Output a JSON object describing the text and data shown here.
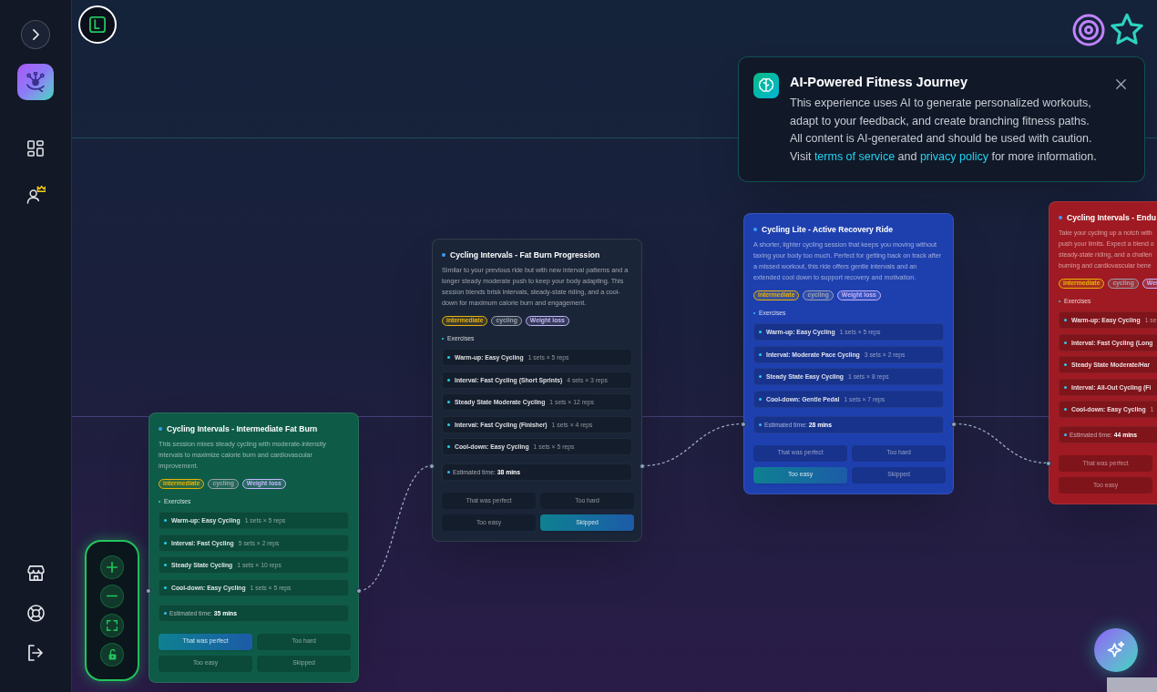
{
  "notice": {
    "title": "AI-Powered Fitness Journey",
    "body": [
      {
        "kind": "text",
        "text": "This experience uses AI to generate personalized workouts, adapt to your feedback, and create branching fitness paths. All content is AI-generated and should be used with caution. Visit "
      },
      {
        "kind": "link",
        "text": "terms of service"
      },
      {
        "kind": "text",
        "text": " and "
      },
      {
        "kind": "link",
        "text": "privacy policy"
      },
      {
        "kind": "text",
        "text": " for more information."
      }
    ]
  },
  "cards": [
    {
      "title": "Cycling Intervals - Intermediate Fat Burn",
      "description": "This session mixes steady cycling with moderate-intensity intervals to maximize calorie burn and cardiovascular improvement.",
      "color": "#0e5c48",
      "tags": [
        {
          "label": "intermediate",
          "color": "#eab308"
        },
        {
          "label": "cycling",
          "color": "#9ca3af"
        },
        {
          "label": "Weight loss",
          "color": "#c4b5fd"
        }
      ],
      "exercises_heading": "Exercises",
      "exercises": [
        {
          "name": "Warm-up: Easy Cycling",
          "detail": "1 sets × 5 reps"
        },
        {
          "name": "Interval: Fast Cycling",
          "detail": "5 sets × 2 reps"
        },
        {
          "name": "Steady State Cycling",
          "detail": "1 sets × 10 reps"
        },
        {
          "name": "Cool-down: Easy Cycling",
          "detail": "1 sets × 5 reps"
        }
      ],
      "estimate": "Estimated time: **35 mins**",
      "feedback": [
        [
          {
            "label": "That was perfect",
            "selected": true
          },
          {
            "label": "Too hard",
            "selected": false
          }
        ],
        [
          {
            "label": "Too easy",
            "selected": false
          },
          {
            "label": "Skipped",
            "selected": false
          }
        ]
      ]
    },
    {
      "title": "Cycling Intervals - Fat Burn Progression",
      "description": "Similar to your previous ride but with new interval patterns and a longer steady moderate push to keep your body adapting. This session blends brisk intervals, steady-state riding, and a cool-down for maximum calorie burn and engagement.",
      "color": "#1a2538",
      "tags": [
        {
          "label": "intermediate",
          "color": "#eab308"
        },
        {
          "label": "cycling",
          "color": "#9ca3af"
        },
        {
          "label": "Weight loss",
          "color": "#c4b5fd"
        }
      ],
      "exercises_heading": "Exercises",
      "exercises": [
        {
          "name": "Warm-up: Easy Cycling",
          "detail": "1 sets × 5 reps"
        },
        {
          "name": "Interval: Fast Cycling (Short Sprints)",
          "detail": "4 sets × 3 reps"
        },
        {
          "name": "Steady State Moderate Cycling",
          "detail": "1 sets × 12 reps"
        },
        {
          "name": "Interval: Fast Cycling (Finisher)",
          "detail": "1 sets × 4 reps"
        },
        {
          "name": "Cool-down: Easy Cycling",
          "detail": "1 sets × 5 reps"
        }
      ],
      "estimate": "Estimated time: **38 mins**",
      "feedback": [
        [
          {
            "label": "That was perfect",
            "selected": false
          },
          {
            "label": "Too hard",
            "selected": false
          }
        ],
        [
          {
            "label": "Too easy",
            "selected": false
          },
          {
            "label": "Skipped",
            "selected": true
          }
        ]
      ]
    },
    {
      "title": "Cycling Lite - Active Recovery Ride",
      "description": "A shorter, lighter cycling session that keeps you moving without taxing your body too much. Perfect for getting back on track after a missed workout, this ride offers gentle intervals and an extended cool down to support recovery and motivation.",
      "color": "#1e40af",
      "tags": [
        {
          "label": "intermediate",
          "color": "#eab308"
        },
        {
          "label": "cycling",
          "color": "#9ca3af"
        },
        {
          "label": "Weight loss",
          "color": "#c4b5fd"
        }
      ],
      "exercises_heading": "Exercises",
      "exercises": [
        {
          "name": "Warm-up: Easy Cycling",
          "detail": "1 sets × 5 reps"
        },
        {
          "name": "Interval: Moderate Pace Cycling",
          "detail": "3 sets × 2 reps"
        },
        {
          "name": "Steady State Easy Cycling",
          "detail": "1 sets × 8 reps"
        },
        {
          "name": "Cool-down: Gentle Pedal",
          "detail": "1 sets × 7 reps"
        }
      ],
      "estimate": "Estimated time: **28 mins**",
      "feedback": [
        [
          {
            "label": "That was perfect",
            "selected": false
          },
          {
            "label": "Too hard",
            "selected": false
          }
        ],
        [
          {
            "label": "Too easy",
            "selected": true
          },
          {
            "label": "Skipped",
            "selected": false
          }
        ]
      ]
    },
    {
      "title": "Cycling Intervals - Endu",
      "description": "Take your cycling up a notch with\npush your limits. Expect a blend o\nsteady-state riding, and a challen\nburning and cardiovascular bene",
      "color": "#9f1a22",
      "tags": [
        {
          "label": "intermediate",
          "color": "#eab308"
        },
        {
          "label": "cycling",
          "color": "#9ca3af"
        },
        {
          "label": "Wei",
          "color": "#c4b5fd"
        }
      ],
      "exercises_heading": "Exercises",
      "exercises": [
        {
          "name": "Warm-up: Easy Cycling",
          "detail": "1 se"
        },
        {
          "name": "Interval: Fast Cycling (Long"
        },
        {
          "name": "Steady State Moderate/Har"
        },
        {
          "name": "Interval: All-Out Cycling (Fi"
        },
        {
          "name": "Cool-down: Easy Cycling",
          "detail": "1"
        }
      ],
      "estimate": "Estimated time: **44 mins**",
      "feedback": [
        [
          {
            "label": "That was perfect",
            "selected": false
          }
        ],
        [
          {
            "label": "Too easy",
            "selected": false
          }
        ]
      ]
    }
  ]
}
